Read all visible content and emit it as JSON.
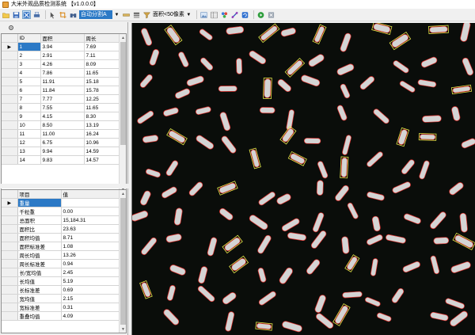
{
  "window": {
    "title": "大米外观品质检测系统 【v1.0.0.0】"
  },
  "toolbar": {
    "segment_mode": "自动分割A",
    "area_label": "面积<50像素"
  },
  "grid1": {
    "columns": [
      "ID",
      "面积",
      "周长"
    ],
    "rows": [
      [
        "1",
        "3.94",
        "7.69"
      ],
      [
        "2",
        "2.91",
        "7.11"
      ],
      [
        "3",
        "4.26",
        "8.09"
      ],
      [
        "4",
        "7.86",
        "11.65"
      ],
      [
        "5",
        "11.91",
        "15.18"
      ],
      [
        "6",
        "11.84",
        "15.78"
      ],
      [
        "7",
        "7.77",
        "12.25"
      ],
      [
        "8",
        "7.55",
        "11.65"
      ],
      [
        "9",
        "4.15",
        "8.30"
      ],
      [
        "10",
        "8.50",
        "13.19"
      ],
      [
        "11",
        "11.00",
        "16.24"
      ],
      [
        "12",
        "6.75",
        "10.96"
      ],
      [
        "13",
        "9.94",
        "14.59"
      ],
      [
        "14",
        "9.83",
        "14.57"
      ]
    ]
  },
  "grid2": {
    "columns": [
      "项目",
      "值"
    ],
    "rows": [
      [
        "重量",
        ""
      ],
      [
        "千粒重",
        "0.00"
      ],
      [
        "总面积",
        "15,184.31"
      ],
      [
        "面积比",
        "23.63"
      ],
      [
        "面积均值",
        "8.71"
      ],
      [
        "面积标准差",
        "1.08"
      ],
      [
        "周长均值",
        "13.26"
      ],
      [
        "周长标准差",
        "0.94"
      ],
      [
        "长/宽均值",
        "2.45"
      ],
      [
        "长均值",
        "5.19"
      ],
      [
        "长标准差",
        "0.69"
      ],
      [
        "宽均值",
        "2.15"
      ],
      [
        "宽标准差",
        "0.31"
      ],
      [
        "重叠均值",
        "4.09"
      ]
    ]
  },
  "colors": {
    "accent": "#2b79c6",
    "image_bg": "#0a0d0a",
    "grain": "#d4d4d4",
    "outline_red": "#e0302c",
    "box_yellow": "#e6e64a"
  }
}
